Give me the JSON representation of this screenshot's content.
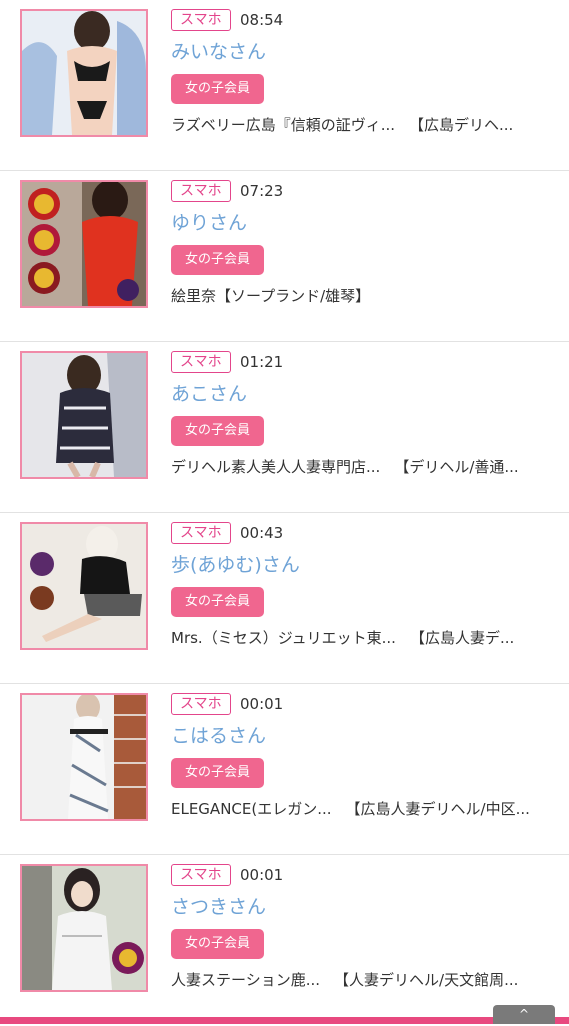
{
  "items": [
    {
      "device": "スマホ",
      "time": "08:54",
      "name": "みいなさん",
      "badge": "女の子会員",
      "shop": "ラズベリー広島『信頼の証ヴィ...",
      "category": "【広島デリヘ..."
    },
    {
      "device": "スマホ",
      "time": "07:23",
      "name": "ゆりさん",
      "badge": "女の子会員",
      "shop": "絵里奈【ソープランド/雄琴】",
      "category": ""
    },
    {
      "device": "スマホ",
      "time": "01:21",
      "name": "あこさん",
      "badge": "女の子会員",
      "shop": "デリヘル素人美人人妻専門店...",
      "category": "【デリヘル/善通..."
    },
    {
      "device": "スマホ",
      "time": "00:43",
      "name": "歩(あゆむ)さん",
      "badge": "女の子会員",
      "shop": "Mrs.（ミセス）ジュリエット東...",
      "category": "【広島人妻デ..."
    },
    {
      "device": "スマホ",
      "time": "00:01",
      "name": "こはるさん",
      "badge": "女の子会員",
      "shop": "ELEGANCE(エレガン...",
      "category": "【広島人妻デリヘル/中区..."
    },
    {
      "device": "スマホ",
      "time": "00:01",
      "name": "さつきさん",
      "badge": "女の子会員",
      "shop": "人妻ステーション鹿...",
      "category": "【人妻デリヘル/天文館周..."
    }
  ],
  "scroll_top_button": {
    "label": "^"
  }
}
